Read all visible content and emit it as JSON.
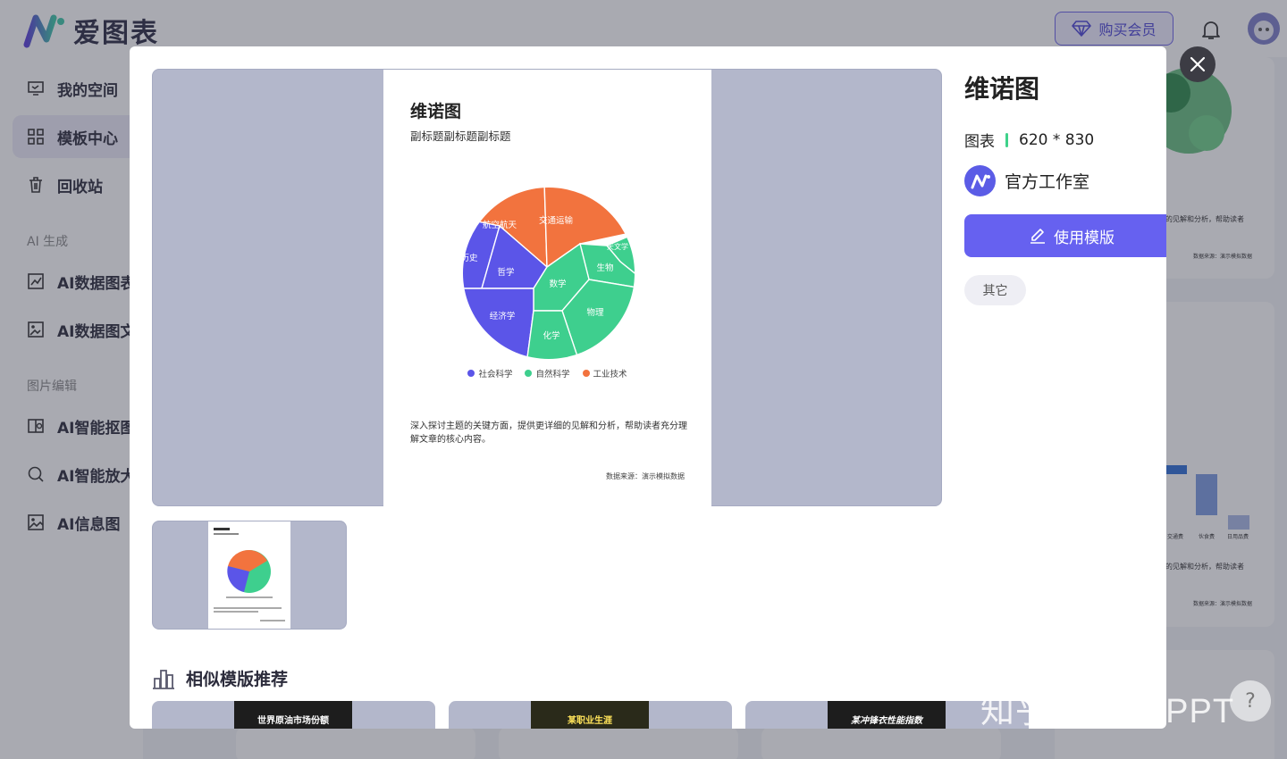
{
  "app": {
    "logo_text": "爱图表",
    "vip_label": "购买会员"
  },
  "sidebar": {
    "items": [
      {
        "label": "我的空间"
      },
      {
        "label": "模板中心"
      },
      {
        "label": "回收站"
      },
      {
        "label": "AI数据图表"
      },
      {
        "label": "AI数据图文"
      },
      {
        "label": "AI智能抠图"
      },
      {
        "label": "AI智能放大"
      },
      {
        "label": "AI信息图"
      }
    ],
    "section_ai": "AI 生成",
    "section_image": "图片编辑"
  },
  "background": {
    "texts": [
      "的见解和分析，帮助读者",
      "数据来源：演示模拟数据",
      "交通费",
      "伙食费",
      "日用品费",
      "的见解和分析，帮助读者",
      "数据来源：演示模拟数据"
    ]
  },
  "modal": {
    "title": "维诺图",
    "category": "图表",
    "size": "620 * 830",
    "author": "官方工作室",
    "use_button": "使用模版",
    "tag": "其它",
    "similar_title": "相似模版推荐",
    "similar_cards": [
      "世界原油市场份额",
      "某职业生涯",
      "某冲锋衣性能指数"
    ]
  },
  "preview": {
    "title": "维诺图",
    "subtitle": "副标题副标题副标题",
    "description": "深入探讨主题的关键方面，提供更详细的见解和分析，帮助读者充分理解文章的核心内容。",
    "source": "数据来源：演示模拟数据",
    "legend": [
      {
        "name": "社会科学",
        "color": "#5b55e8"
      },
      {
        "name": "自然科学",
        "color": "#3ecf8e"
      },
      {
        "name": "工业技术",
        "color": "#f2733e"
      }
    ],
    "cells": [
      {
        "label": "航空航天",
        "group": "工业技术"
      },
      {
        "label": "交通运输",
        "group": "工业技术"
      },
      {
        "label": "天文学",
        "group": "自然科学"
      },
      {
        "label": "历史",
        "group": "社会科学"
      },
      {
        "label": "哲学",
        "group": "社会科学"
      },
      {
        "label": "生物",
        "group": "自然科学"
      },
      {
        "label": "数学",
        "group": "自然科学"
      },
      {
        "label": "物理",
        "group": "自然科学"
      },
      {
        "label": "经济学",
        "group": "社会科学"
      },
      {
        "label": "化学",
        "group": "自然科学"
      }
    ]
  },
  "watermark": "知乎 @小软PPT",
  "help": "?"
}
